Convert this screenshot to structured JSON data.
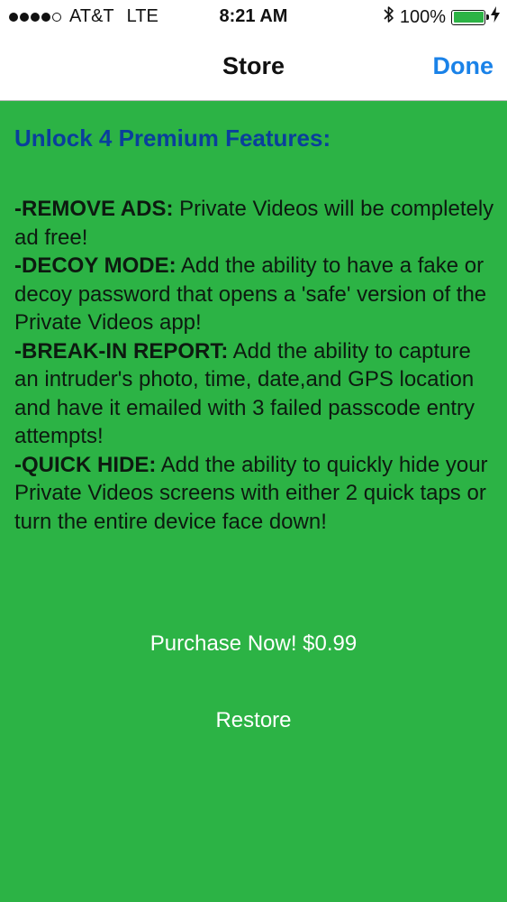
{
  "status_bar": {
    "carrier": "AT&T",
    "network": "LTE",
    "time": "8:21 AM",
    "battery": "100%",
    "battery_level": 1.0,
    "signal_bars": 4,
    "signal_max": 5,
    "icons": [
      "bluetooth-icon",
      "battery-icon",
      "charging-bolt-icon"
    ]
  },
  "nav": {
    "title": "Store",
    "done_label": "Done"
  },
  "content": {
    "heading": "Unlock 4 Premium Features:",
    "features": [
      {
        "label": "-REMOVE ADS:",
        "text": " Private Videos will be completely ad free!"
      },
      {
        "label": "-DECOY MODE:",
        "text": " Add the ability to have a fake or decoy password that opens a 'safe' version of the Private Videos app!"
      },
      {
        "label": "-BREAK-IN REPORT:",
        "text": " Add the ability to capture an intruder's photo, time, date,and GPS location and have it emailed with 3 failed passcode entry attempts!"
      },
      {
        "label": "-QUICK HIDE:",
        "text": " Add the ability to quickly hide your Private Videos screens with either 2 quick taps or turn the entire device face down!"
      }
    ]
  },
  "actions": {
    "purchase_label": "Purchase Now! $0.99",
    "restore_label": "Restore"
  },
  "colors": {
    "background": "#2cb345",
    "heading": "#0a3f9c",
    "link": "#1a82e8",
    "button_text": "#ffffff"
  }
}
